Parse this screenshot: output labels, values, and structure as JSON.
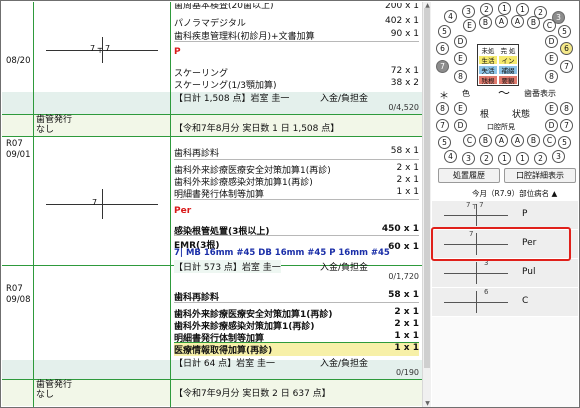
{
  "visit1": {
    "date": "08/20",
    "lines_top": [
      {
        "name": "歯周基本検査(20歯以上)",
        "value": "200 x 1"
      },
      {
        "name": "パノラマデジタル",
        "value": "402 x 1"
      },
      {
        "name": "歯科疾患管理料(初診月)+文書加算",
        "value": "90 x 1"
      }
    ],
    "chart_label": "7 ┬ 7",
    "diagnosis": "P",
    "lines_bottom": [
      {
        "name": "スケーリング",
        "value": "72 x 1"
      },
      {
        "name": "スケーリング(1/3顎加算)",
        "value": "38 x 2"
      }
    ],
    "total": "【日計 1,508 点】岩室 圭一",
    "burden_label": "入金/負担金",
    "burden_value": "0/4,520",
    "issue_label": "歯管発行",
    "issue_value": "なし",
    "monthly": "【令和7年8月分 実日数 1 日  1,508 点】"
  },
  "visit2": {
    "year": "R07",
    "date": "09/01",
    "lines": [
      {
        "name": "歯科再診料",
        "value": "58 x 1"
      },
      {
        "name": "歯科外来診療医療安全対策加算1(再診)",
        "value": "2 x 1"
      },
      {
        "name": "歯科外来診療感染対策加算1(再診)",
        "value": "2 x 1"
      },
      {
        "name": "明細書発行体制等加算",
        "value": "1 x 1"
      }
    ],
    "chart_label": "7",
    "diagnosis": "Per",
    "treat1": {
      "name": "感染根管処置(3根以上)",
      "value": "450 x 1"
    },
    "treat2": {
      "name": "EMR(3根)",
      "value": "60 x 1"
    },
    "treat2_detail": "7| MB 16mm #45 DB 16mm #45 P 16mm #45",
    "total": "【日計 573 点】岩室 圭一",
    "burden_label": "入金/負担金",
    "burden_value": "0/1,720"
  },
  "visit3": {
    "year": "R07",
    "date": "09/08",
    "lines": [
      {
        "name": "歯科再診料",
        "value": "58 x 1"
      },
      {
        "name": "歯科外来診療医療安全対策加算1(再診)",
        "value": "2 x 1"
      },
      {
        "name": "歯科外来診療感染対策加算1(再診)",
        "value": "2 x 1"
      },
      {
        "name": "明細書発行体制等加算",
        "value": "1 x 1"
      },
      {
        "name": "医療情報取得加算(再診)",
        "value": "1 x 1"
      }
    ],
    "total": "【日計 64 点】岩室 圭一",
    "burden_label": "入金/負担金",
    "burden_value": "0/190",
    "issue_label": "歯管発行",
    "issue_value": "なし",
    "monthly": "【令和7年9月分 実日数 2 日  637 点】"
  },
  "right": {
    "teeth_top": [
      "4",
      "3",
      "2",
      "1",
      "1",
      "2",
      "3"
    ],
    "tooth_A": "A",
    "tooth_B": "B",
    "tooth_C": "C",
    "tooth_D": "D",
    "tooth_E": "E",
    "tooth_5": "5",
    "tooth_6": "6",
    "tooth_7": "7",
    "tooth_8": "8",
    "grid": [
      [
        "未処置",
        "完 処"
      ],
      [
        "生活",
        "インレー"
      ],
      [
        "失活",
        "補綴"
      ],
      [
        "残根",
        "要観"
      ]
    ],
    "grid_colors": [
      [
        "#ffffff",
        "#ffffff"
      ],
      [
        "#f5ea6e",
        "#f5ea6e"
      ],
      [
        "#8ec5e8",
        "#8ec5e8"
      ],
      [
        "#e07b6e",
        "#e07b6e"
      ]
    ],
    "legend_star": "＊",
    "legend_color": "色",
    "legend_wave": "〜",
    "legend_display": "歯番表示",
    "label_root": "根",
    "label_status": "状態",
    "label_oral": "口腔所見",
    "btn_history": "処置履歴",
    "btn_detail": "口腔詳細表示",
    "header_period": "今月（R7.9）部位病名 ▲",
    "list": [
      {
        "tl": "7 ┬ 7",
        "label": "P"
      },
      {
        "tl": "7",
        "label": "Per"
      },
      {
        "tl": "3",
        "label": "Pul"
      },
      {
        "tl": "6",
        "label": "C"
      }
    ]
  }
}
